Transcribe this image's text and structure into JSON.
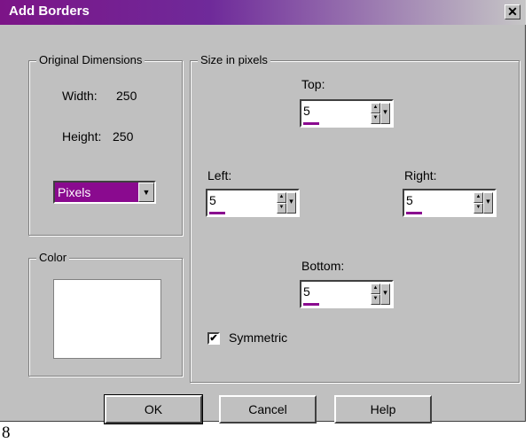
{
  "window": {
    "title": "Add Borders",
    "close_glyph": "✖"
  },
  "original_dimensions": {
    "legend": "Original Dimensions",
    "width_label": "Width:",
    "width_value": "250",
    "height_label": "Height:",
    "height_value": "250",
    "units_selected": "Pixels"
  },
  "color_group": {
    "legend": "Color",
    "swatch_color": "#ffffff"
  },
  "size_in_pixels": {
    "legend": "Size in pixels",
    "top": {
      "label": "Top:",
      "value": "5"
    },
    "left": {
      "label": "Left:",
      "value": "5"
    },
    "right": {
      "label": "Right:",
      "value": "5"
    },
    "bottom": {
      "label": "Bottom:",
      "value": "5"
    },
    "symmetric": {
      "label": "Symmetric",
      "checked": true
    }
  },
  "buttons": {
    "ok": "OK",
    "cancel": "Cancel",
    "help": "Help"
  },
  "stray_text": "8",
  "icons": {
    "spin_up": "▲",
    "spin_down": "▼",
    "dropdown": "▼",
    "check": "✔"
  },
  "colors": {
    "accent": "#8a0a8f",
    "title_start": "#7c1487",
    "dialog_bg": "#c0c0c0"
  }
}
